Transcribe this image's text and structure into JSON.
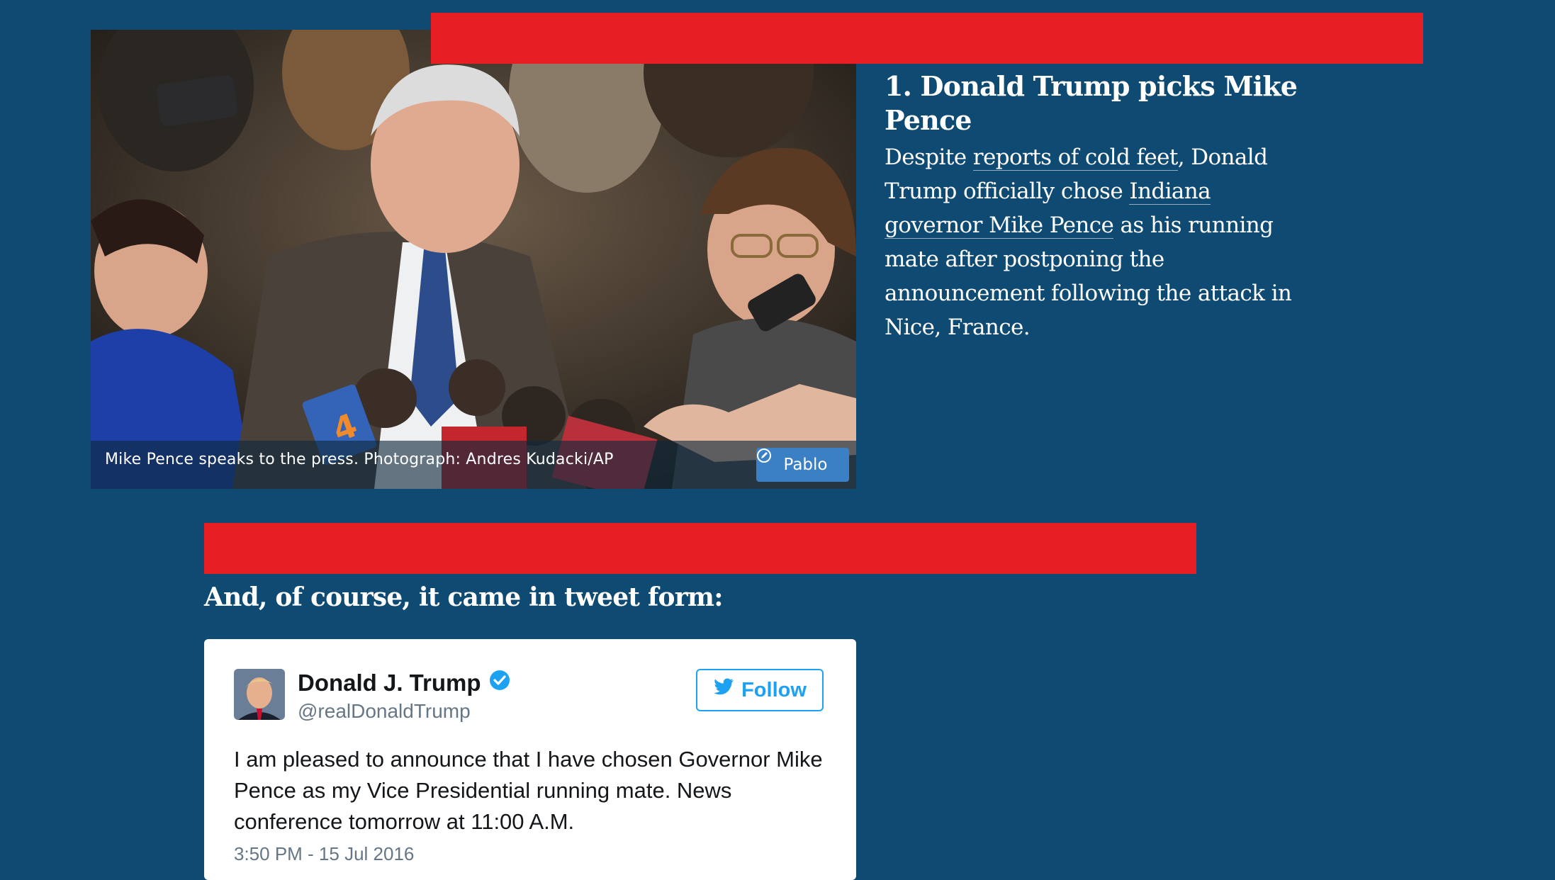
{
  "colors": {
    "page_background": "#0f4a73",
    "accent_bar": "#e81e25",
    "pablo_button": "#3b7fc4",
    "twitter_blue": "#1da1f2"
  },
  "photo": {
    "caption": "Mike Pence speaks to the press. Photograph: Andres Kudacki/AP",
    "pablo_label": "Pablo",
    "pablo_icon": "pencil-circle-icon"
  },
  "article": {
    "headline": "1. Donald Trump picks Mike Pence",
    "body": {
      "part1": "Despite ",
      "link1": "reports of cold feet",
      "part2": ", Donald Trump officially chose ",
      "link2": "Indiana governor Mike Pence",
      "part3": " as his running mate after postponing the announcement following the attack in Nice, France."
    },
    "subhead": "And, of course, it came in tweet form:"
  },
  "tweet": {
    "author_name": "Donald J. Trump",
    "author_handle": "@realDonaldTrump",
    "verified_icon": "verified-badge-icon",
    "follow_label": "Follow",
    "follow_icon": "twitter-bird-icon",
    "text": "I am pleased to announce that I have chosen Governor Mike Pence as my Vice Presidential running mate. News conference tomorrow at 11:00 A.M.",
    "date": "3:50 PM - 15 Jul 2016"
  }
}
